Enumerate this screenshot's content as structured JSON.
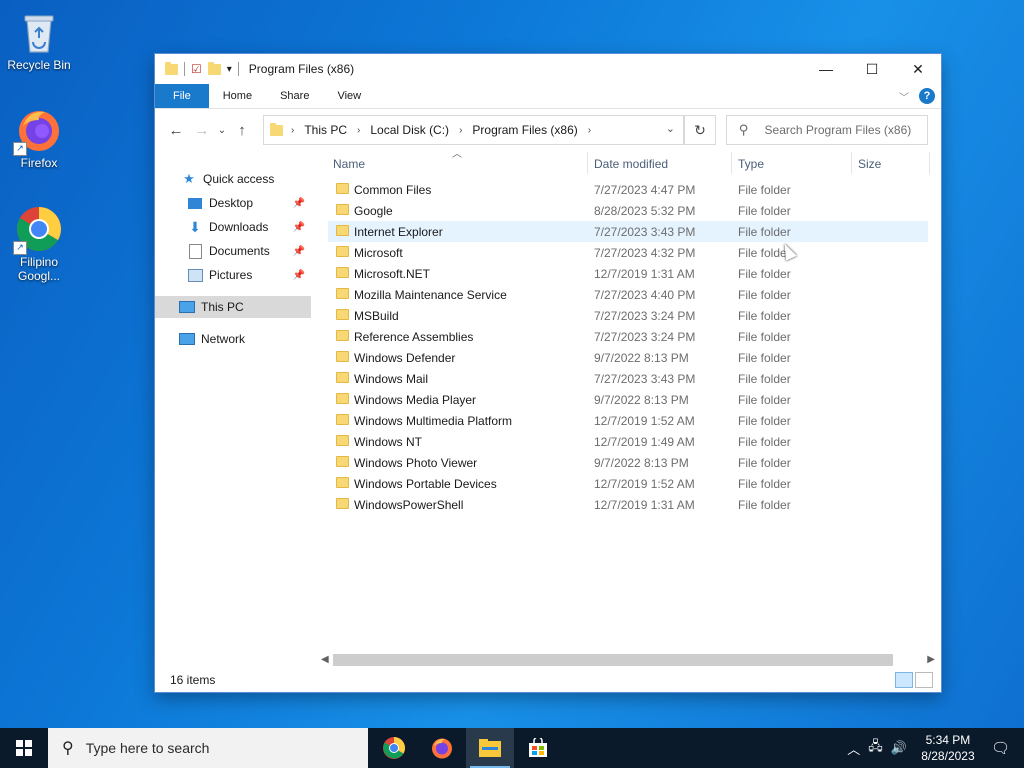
{
  "desktop": {
    "icons": [
      {
        "label": "Recycle Bin",
        "icon": "recycle-bin-icon"
      },
      {
        "label": "Firefox",
        "icon": "firefox-icon"
      },
      {
        "label": "Filipino Googl...",
        "icon": "chrome-icon"
      }
    ]
  },
  "window": {
    "title": "Program Files (x86)",
    "ribbon_tabs": [
      "File",
      "Home",
      "Share",
      "View"
    ],
    "address": {
      "crumbs": [
        "This PC",
        "Local Disk (C:)",
        "Program Files (x86)"
      ]
    },
    "search_placeholder": "Search Program Files (x86)",
    "nav": {
      "quick_access": "Quick access",
      "pinned": [
        "Desktop",
        "Downloads",
        "Documents",
        "Pictures"
      ],
      "this_pc": "This PC",
      "network": "Network"
    },
    "columns": [
      "Name",
      "Date modified",
      "Type",
      "Size"
    ],
    "files": [
      {
        "name": "Common Files",
        "date": "7/27/2023 4:47 PM",
        "type": "File folder"
      },
      {
        "name": "Google",
        "date": "8/28/2023 5:32 PM",
        "type": "File folder"
      },
      {
        "name": "Internet Explorer",
        "date": "7/27/2023 3:43 PM",
        "type": "File folder"
      },
      {
        "name": "Microsoft",
        "date": "7/27/2023 4:32 PM",
        "type": "File folder"
      },
      {
        "name": "Microsoft.NET",
        "date": "12/7/2019 1:31 AM",
        "type": "File folder"
      },
      {
        "name": "Mozilla Maintenance Service",
        "date": "7/27/2023 4:40 PM",
        "type": "File folder"
      },
      {
        "name": "MSBuild",
        "date": "7/27/2023 3:24 PM",
        "type": "File folder"
      },
      {
        "name": "Reference Assemblies",
        "date": "7/27/2023 3:24 PM",
        "type": "File folder"
      },
      {
        "name": "Windows Defender",
        "date": "9/7/2022 8:13 PM",
        "type": "File folder"
      },
      {
        "name": "Windows Mail",
        "date": "7/27/2023 3:43 PM",
        "type": "File folder"
      },
      {
        "name": "Windows Media Player",
        "date": "9/7/2022 8:13 PM",
        "type": "File folder"
      },
      {
        "name": "Windows Multimedia Platform",
        "date": "12/7/2019 1:52 AM",
        "type": "File folder"
      },
      {
        "name": "Windows NT",
        "date": "12/7/2019 1:49 AM",
        "type": "File folder"
      },
      {
        "name": "Windows Photo Viewer",
        "date": "9/7/2022 8:13 PM",
        "type": "File folder"
      },
      {
        "name": "Windows Portable Devices",
        "date": "12/7/2019 1:52 AM",
        "type": "File folder"
      },
      {
        "name": "WindowsPowerShell",
        "date": "12/7/2019 1:31 AM",
        "type": "File folder"
      }
    ],
    "hovered_index": 2,
    "status": "16 items"
  },
  "taskbar": {
    "search_text": "Type here to search",
    "apps": [
      "chrome-icon",
      "firefox-icon",
      "file-explorer-icon",
      "store-icon"
    ],
    "time": "5:34 PM",
    "date": "8/28/2023"
  },
  "colors": {
    "accent": "#1979ca",
    "folder": "#f8d775",
    "hover": "#e5f3ff"
  }
}
